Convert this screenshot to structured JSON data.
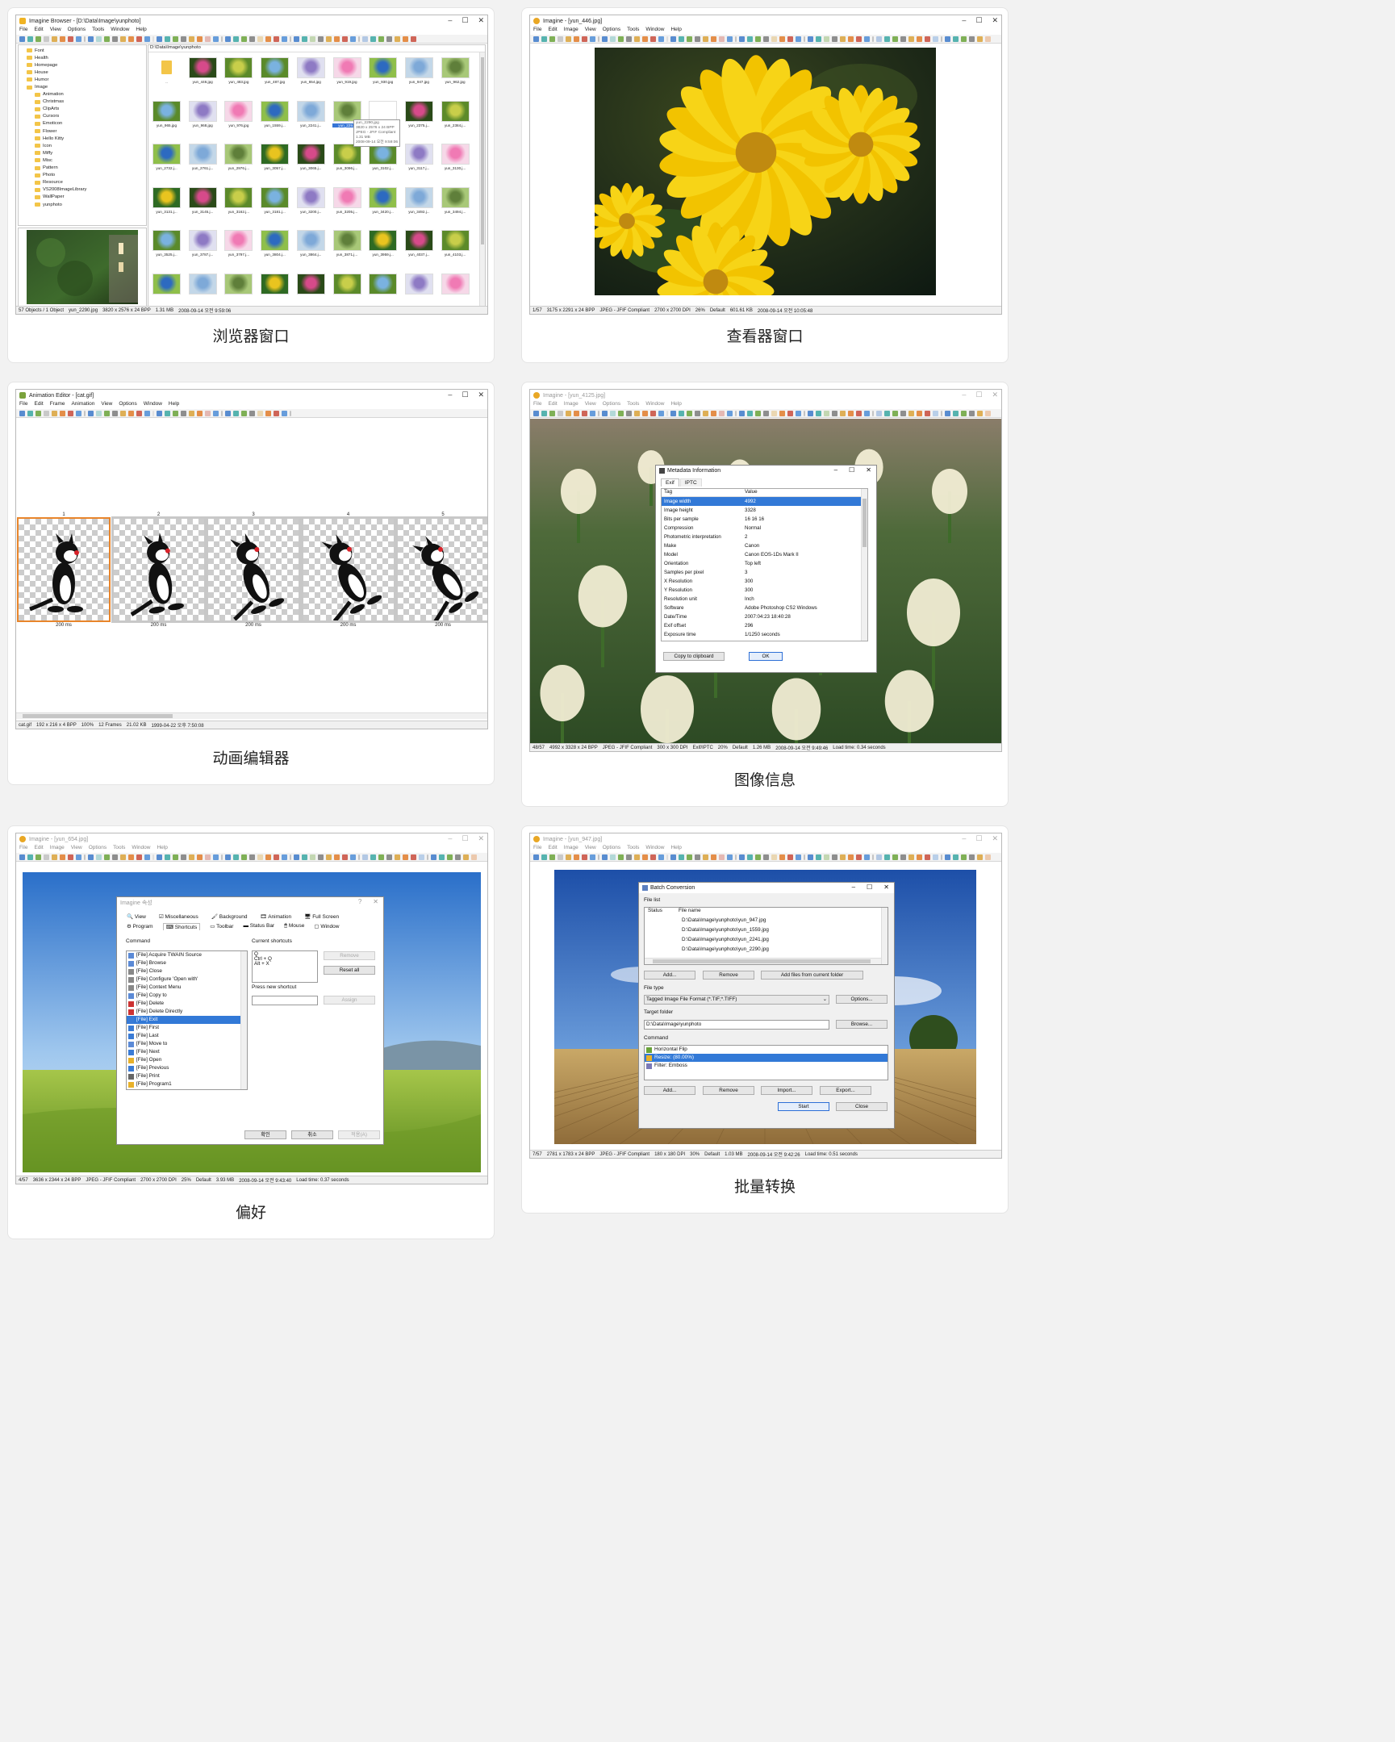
{
  "colors": {
    "selection": "#3279d7",
    "accent_orange": "#e8852b",
    "tooltip_text": "#666666"
  },
  "cards": [
    {
      "caption": "浏览器窗口"
    },
    {
      "caption": "查看器窗口"
    },
    {
      "caption": "动画编辑器"
    },
    {
      "caption": "图像信息"
    },
    {
      "caption": "偏好"
    },
    {
      "caption": "批量转换"
    }
  ],
  "browser": {
    "title": "Imagine Browser - [D:\\Data\\Image\\yunphoto]",
    "menu": [
      "File",
      "Edit",
      "View",
      "Options",
      "Tools",
      "Window",
      "Help"
    ],
    "path": "D:\\Data\\Image\\yunphoto",
    "tree": [
      "Font",
      "Health",
      "Homepage",
      "House",
      "Humor",
      "Image",
      "Animation",
      "Christmas",
      "ClipArts",
      "Cursors",
      "Emoticon",
      "Flower",
      "Hello Kitty",
      "Icon",
      "Miffy",
      "Misc",
      "Pattern",
      "Photo",
      "Resource",
      "VS2008ImageLibrary",
      "WallPaper",
      "yunphoto"
    ],
    "thumbs": [
      [
        "..",
        "yun_446.jpg",
        "yun_483.jpg",
        "yun_487.jpg",
        "yun_654.jpg",
        "yun_919.jpg",
        "yun_930.jpg",
        "yun_947.jpg",
        "yun_962.jpg"
      ],
      [
        "yun_965.jpg",
        "yun_968.jpg",
        "yun_976.jpg",
        "yun_1559.j...",
        "yun_2241.j...",
        "yun_229...",
        "",
        "yun_2375.j...",
        "yun_2384.j..."
      ],
      [
        "yun_2732.j...",
        "yun_2761.j...",
        "yun_2976.j...",
        "yun_3057.j...",
        "yun_3065.j...",
        "yun_3096.j...",
        "yun_3102.j...",
        "yun_3117.j...",
        "yun_3130.j..."
      ],
      [
        "yun_3131.j...",
        "yun_3145.j...",
        "yun_3162.j...",
        "yun_3181.j...",
        "yun_3200.j...",
        "yun_3205.j...",
        "yun_3420.j...",
        "yun_3492.j...",
        "yun_3494.j..."
      ],
      [
        "yun_3525.j...",
        "yun_3787.j...",
        "yun_3797.j...",
        "yun_3804.j...",
        "yun_3864.j...",
        "yun_3871.j...",
        "yun_3959.j...",
        "yun_4037.j...",
        "yun_4103.j..."
      ],
      [
        "",
        "",
        "",
        "",
        "",
        "",
        "",
        "",
        ""
      ]
    ],
    "tooltip": [
      "yun_2290.jpg",
      "3820 x 2576 x 24 BPP",
      "JPEG - JFIF Compliant",
      "1.31 MB",
      "2008-09-14 오전 9:59:06"
    ],
    "status": [
      "57 Objects / 1 Object",
      "yun_2290.jpg",
      "3820 x 2576 x 24 BPP",
      "1.31 MB",
      "2008-09-14 오전 9:59:06"
    ]
  },
  "viewer": {
    "title": "Imagine - [yun_446.jpg]",
    "menu": [
      "File",
      "Edit",
      "Image",
      "View",
      "Options",
      "Tools",
      "Window",
      "Help"
    ],
    "status": [
      "1/57",
      "3175 x 2291 x 24 BPP",
      "JPEG - JFIF Compliant",
      "2700 x 2700 DPI",
      "26%",
      "Default",
      "601.61 KB",
      "2008-09-14 오전 10:05:48"
    ]
  },
  "anim": {
    "title": "Animation Editor - [cat.gif]",
    "menu": [
      "File",
      "Edit",
      "Frame",
      "Animation",
      "View",
      "Options",
      "Window",
      "Help"
    ],
    "frames": [
      {
        "num": "1",
        "ms": "200 ms"
      },
      {
        "num": "2",
        "ms": "200 ms"
      },
      {
        "num": "3",
        "ms": "200 ms"
      },
      {
        "num": "4",
        "ms": "200 ms"
      },
      {
        "num": "5",
        "ms": "200 ms"
      }
    ],
    "status": [
      "cat.gif",
      "192 x 216 x 4 BPP",
      "100%",
      "12 Frames",
      "21.02 KB",
      "1999-04-22 오후 7:50:08"
    ]
  },
  "meta": {
    "title": "Imagine - [yun_4125.jpg]",
    "menu": [
      "File",
      "Edit",
      "Image",
      "View",
      "Options",
      "Tools",
      "Window",
      "Help"
    ],
    "dialog_title": "Metadata Information",
    "tabs": [
      "Exif",
      "IPTC"
    ],
    "col_tag": "Tag",
    "col_value": "Value",
    "rows": [
      [
        "Image width",
        "4992"
      ],
      [
        "Image height",
        "3328"
      ],
      [
        "Bits per sample",
        "16 16 16"
      ],
      [
        "Compression",
        "Normal"
      ],
      [
        "Photometric interpretation",
        "2"
      ],
      [
        "Make",
        "Canon"
      ],
      [
        "Model",
        "Canon EOS-1Ds Mark II"
      ],
      [
        "Orientation",
        "Top left"
      ],
      [
        "Samples per pixel",
        "3"
      ],
      [
        "X Resolution",
        "300"
      ],
      [
        "Y Resolution",
        "300"
      ],
      [
        "Resolution unit",
        "Inch"
      ],
      [
        "Software",
        "Adobe Photoshop CS2 Windows"
      ],
      [
        "Date/Time",
        "2007:04:23 18:40:28"
      ],
      [
        "Exif offset",
        "296"
      ],
      [
        "Exposure time",
        "1/1250 seconds"
      ]
    ],
    "copy_btn": "Copy to clipboard",
    "ok_btn": "OK",
    "status": [
      "48/57",
      "4992 x 3328 x 24 BPP",
      "JPEG - JFIF Compliant",
      "300 x 300 DPI",
      "Exif/IPTC",
      "20%",
      "Default",
      "1.26 MB",
      "2008-09-14 오전 9:49:46",
      "Load time: 0.34 seconds"
    ]
  },
  "prefs": {
    "title": "Imagine - [yun_654.jpg]",
    "menu": [
      "File",
      "Edit",
      "Image",
      "View",
      "Options",
      "Tools",
      "Window",
      "Help"
    ],
    "dialog_title": "Imagine 속성",
    "tabs_row1": [
      "View",
      "Miscellaneous",
      "Background",
      "Animation",
      "Full Screen"
    ],
    "tabs_row2": [
      "Program",
      "Shortcuts",
      "Toolbar",
      "Status Bar",
      "Mouse",
      "Window"
    ],
    "command_label": "Command",
    "commands": [
      "[File] Acquire TWAIN Source",
      "[File] Browse",
      "[File] Close",
      "[File] Configure 'Open with'",
      "[File] Context Menu",
      "[File] Copy to",
      "[File] Delete",
      "[File] Delete Directly",
      "[File] Exit",
      "[File] First",
      "[File] Last",
      "[File] Move to",
      "[File] Next",
      "[File] Open",
      "[File] Previous",
      "[File] Print",
      "[File] Program1"
    ],
    "current_label": "Current shortcuts",
    "current": [
      "Q",
      "Ctrl + Q",
      "Alt + X"
    ],
    "remove": "Remove",
    "reset_all": "Reset all",
    "press_label": "Press new shortcut",
    "assign": "Assign",
    "ok": "확인",
    "cancel": "취소",
    "apply": "적용(A)",
    "status": [
      "4/57",
      "3636 x 2344 x 24 BPP",
      "JPEG - JFIF Compliant",
      "2700 x 2700 DPI",
      "25%",
      "Default",
      "3.93 MB",
      "2008-09-14 오전 9:43:40",
      "Load time: 0.37 seconds"
    ]
  },
  "batch": {
    "title": "Imagine - [yun_947.jpg]",
    "menu": [
      "File",
      "Edit",
      "Image",
      "View",
      "Options",
      "Tools",
      "Window",
      "Help"
    ],
    "dialog_title": "Batch Conversion",
    "file_list_label": "File list",
    "col_status": "Status",
    "col_file": "File name",
    "files": [
      "D:\\Data\\Image\\yunphoto\\yun_947.jpg",
      "D:\\Data\\Image\\yunphoto\\yun_1559.jpg",
      "D:\\Data\\Image\\yunphoto\\yun_2241.jpg",
      "D:\\Data\\Image\\yunphoto\\yun_2290.jpg"
    ],
    "add": "Add...",
    "remove": "Remove",
    "add_folder": "Add files from current folder",
    "file_type_label": "File type",
    "file_type": "Tagged Image File Format (*.TIF;*.TIFF)",
    "options": "Options...",
    "target_label": "Target folder",
    "target": "D:\\Data\\Image\\yunphoto",
    "browse": "Browse...",
    "command_label": "Command",
    "commands": [
      "Horizontal Flip",
      "Resize: (80.00%)",
      "Filter: Emboss"
    ],
    "cmd_add": "Add...",
    "cmd_remove": "Remove",
    "import": "Import...",
    "export": "Export...",
    "start": "Start",
    "close": "Close",
    "status": [
      "7/57",
      "2781 x 1783 x 24 BPP",
      "JPEG - JFIF Compliant",
      "180 x 180 DPI",
      "30%",
      "Default",
      "1.03 MB",
      "2008-09-14 오전 9:42:26",
      "Load time: 0.51 seconds"
    ]
  }
}
